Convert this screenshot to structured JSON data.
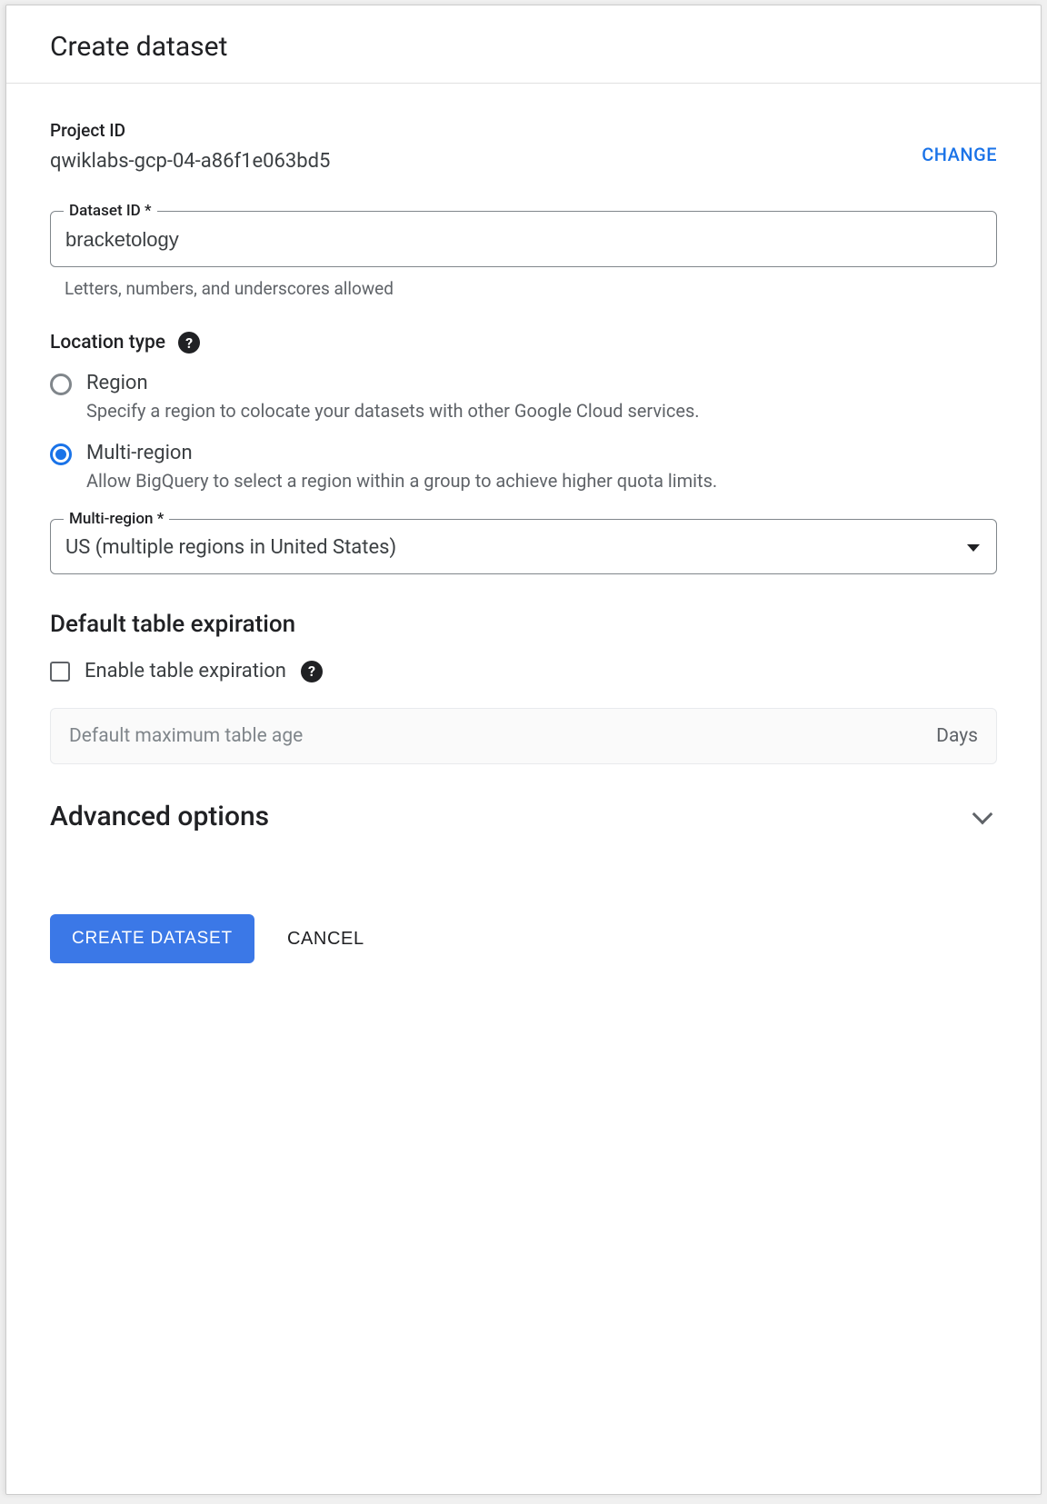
{
  "header": {
    "title": "Create dataset"
  },
  "project": {
    "label": "Project ID",
    "value": "qwiklabs-gcp-04-a86f1e063bd5",
    "change_label": "CHANGE"
  },
  "dataset_id": {
    "label": "Dataset ID *",
    "value": "bracketology",
    "helper": "Letters, numbers, and underscores allowed"
  },
  "location": {
    "label": "Location type",
    "options": [
      {
        "title": "Region",
        "desc": "Specify a region to colocate your datasets with other Google Cloud services."
      },
      {
        "title": "Multi-region",
        "desc": "Allow BigQuery to select a region within a group to achieve higher quota limits."
      }
    ]
  },
  "multiregion": {
    "label": "Multi-region *",
    "value": "US (multiple regions in United States)"
  },
  "expiration": {
    "heading": "Default table expiration",
    "checkbox_label": "Enable table expiration",
    "placeholder": "Default maximum table age",
    "suffix": "Days"
  },
  "advanced": {
    "title": "Advanced options"
  },
  "buttons": {
    "primary": "CREATE DATASET",
    "cancel": "CANCEL"
  }
}
